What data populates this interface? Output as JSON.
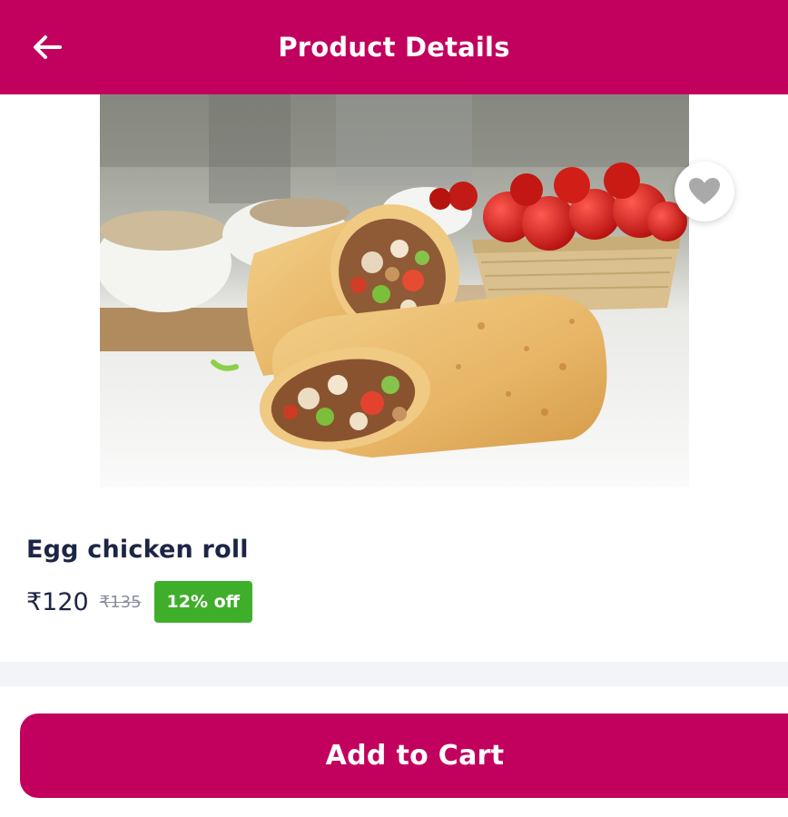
{
  "header": {
    "title": "Product Details",
    "back_icon": "arrow-left-icon",
    "background_color": "#c2005e"
  },
  "product": {
    "name": "Egg chicken roll",
    "price": "₹120",
    "mrp": "₹135",
    "discount": "12% off",
    "favorite_icon": "heart-icon",
    "image_subject": "chicken-wrap-photo"
  },
  "cart": {
    "button_label": "Add to Cart"
  },
  "colors": {
    "brand": "#c2005e",
    "discount_badge": "#3fae2a",
    "text_primary": "#1d2545",
    "text_muted": "#8a8f9e"
  }
}
